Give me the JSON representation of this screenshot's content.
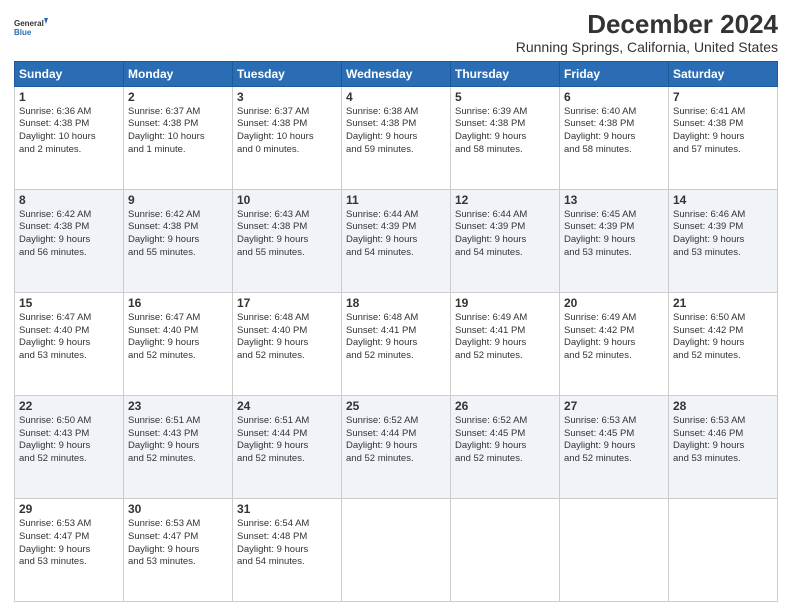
{
  "header": {
    "logo_line1": "General",
    "logo_line2": "Blue",
    "title": "December 2024",
    "subtitle": "Running Springs, California, United States"
  },
  "calendar": {
    "days_of_week": [
      "Sunday",
      "Monday",
      "Tuesday",
      "Wednesday",
      "Thursday",
      "Friday",
      "Saturday"
    ],
    "weeks": [
      [
        {
          "day": "1",
          "lines": [
            "Sunrise: 6:36 AM",
            "Sunset: 4:38 PM",
            "Daylight: 10 hours",
            "and 2 minutes."
          ]
        },
        {
          "day": "2",
          "lines": [
            "Sunrise: 6:37 AM",
            "Sunset: 4:38 PM",
            "Daylight: 10 hours",
            "and 1 minute."
          ]
        },
        {
          "day": "3",
          "lines": [
            "Sunrise: 6:37 AM",
            "Sunset: 4:38 PM",
            "Daylight: 10 hours",
            "and 0 minutes."
          ]
        },
        {
          "day": "4",
          "lines": [
            "Sunrise: 6:38 AM",
            "Sunset: 4:38 PM",
            "Daylight: 9 hours",
            "and 59 minutes."
          ]
        },
        {
          "day": "5",
          "lines": [
            "Sunrise: 6:39 AM",
            "Sunset: 4:38 PM",
            "Daylight: 9 hours",
            "and 58 minutes."
          ]
        },
        {
          "day": "6",
          "lines": [
            "Sunrise: 6:40 AM",
            "Sunset: 4:38 PM",
            "Daylight: 9 hours",
            "and 58 minutes."
          ]
        },
        {
          "day": "7",
          "lines": [
            "Sunrise: 6:41 AM",
            "Sunset: 4:38 PM",
            "Daylight: 9 hours",
            "and 57 minutes."
          ]
        }
      ],
      [
        {
          "day": "8",
          "lines": [
            "Sunrise: 6:42 AM",
            "Sunset: 4:38 PM",
            "Daylight: 9 hours",
            "and 56 minutes."
          ]
        },
        {
          "day": "9",
          "lines": [
            "Sunrise: 6:42 AM",
            "Sunset: 4:38 PM",
            "Daylight: 9 hours",
            "and 55 minutes."
          ]
        },
        {
          "day": "10",
          "lines": [
            "Sunrise: 6:43 AM",
            "Sunset: 4:38 PM",
            "Daylight: 9 hours",
            "and 55 minutes."
          ]
        },
        {
          "day": "11",
          "lines": [
            "Sunrise: 6:44 AM",
            "Sunset: 4:39 PM",
            "Daylight: 9 hours",
            "and 54 minutes."
          ]
        },
        {
          "day": "12",
          "lines": [
            "Sunrise: 6:44 AM",
            "Sunset: 4:39 PM",
            "Daylight: 9 hours",
            "and 54 minutes."
          ]
        },
        {
          "day": "13",
          "lines": [
            "Sunrise: 6:45 AM",
            "Sunset: 4:39 PM",
            "Daylight: 9 hours",
            "and 53 minutes."
          ]
        },
        {
          "day": "14",
          "lines": [
            "Sunrise: 6:46 AM",
            "Sunset: 4:39 PM",
            "Daylight: 9 hours",
            "and 53 minutes."
          ]
        }
      ],
      [
        {
          "day": "15",
          "lines": [
            "Sunrise: 6:47 AM",
            "Sunset: 4:40 PM",
            "Daylight: 9 hours",
            "and 53 minutes."
          ]
        },
        {
          "day": "16",
          "lines": [
            "Sunrise: 6:47 AM",
            "Sunset: 4:40 PM",
            "Daylight: 9 hours",
            "and 52 minutes."
          ]
        },
        {
          "day": "17",
          "lines": [
            "Sunrise: 6:48 AM",
            "Sunset: 4:40 PM",
            "Daylight: 9 hours",
            "and 52 minutes."
          ]
        },
        {
          "day": "18",
          "lines": [
            "Sunrise: 6:48 AM",
            "Sunset: 4:41 PM",
            "Daylight: 9 hours",
            "and 52 minutes."
          ]
        },
        {
          "day": "19",
          "lines": [
            "Sunrise: 6:49 AM",
            "Sunset: 4:41 PM",
            "Daylight: 9 hours",
            "and 52 minutes."
          ]
        },
        {
          "day": "20",
          "lines": [
            "Sunrise: 6:49 AM",
            "Sunset: 4:42 PM",
            "Daylight: 9 hours",
            "and 52 minutes."
          ]
        },
        {
          "day": "21",
          "lines": [
            "Sunrise: 6:50 AM",
            "Sunset: 4:42 PM",
            "Daylight: 9 hours",
            "and 52 minutes."
          ]
        }
      ],
      [
        {
          "day": "22",
          "lines": [
            "Sunrise: 6:50 AM",
            "Sunset: 4:43 PM",
            "Daylight: 9 hours",
            "and 52 minutes."
          ]
        },
        {
          "day": "23",
          "lines": [
            "Sunrise: 6:51 AM",
            "Sunset: 4:43 PM",
            "Daylight: 9 hours",
            "and 52 minutes."
          ]
        },
        {
          "day": "24",
          "lines": [
            "Sunrise: 6:51 AM",
            "Sunset: 4:44 PM",
            "Daylight: 9 hours",
            "and 52 minutes."
          ]
        },
        {
          "day": "25",
          "lines": [
            "Sunrise: 6:52 AM",
            "Sunset: 4:44 PM",
            "Daylight: 9 hours",
            "and 52 minutes."
          ]
        },
        {
          "day": "26",
          "lines": [
            "Sunrise: 6:52 AM",
            "Sunset: 4:45 PM",
            "Daylight: 9 hours",
            "and 52 minutes."
          ]
        },
        {
          "day": "27",
          "lines": [
            "Sunrise: 6:53 AM",
            "Sunset: 4:45 PM",
            "Daylight: 9 hours",
            "and 52 minutes."
          ]
        },
        {
          "day": "28",
          "lines": [
            "Sunrise: 6:53 AM",
            "Sunset: 4:46 PM",
            "Daylight: 9 hours",
            "and 53 minutes."
          ]
        }
      ],
      [
        {
          "day": "29",
          "lines": [
            "Sunrise: 6:53 AM",
            "Sunset: 4:47 PM",
            "Daylight: 9 hours",
            "and 53 minutes."
          ]
        },
        {
          "day": "30",
          "lines": [
            "Sunrise: 6:53 AM",
            "Sunset: 4:47 PM",
            "Daylight: 9 hours",
            "and 53 minutes."
          ]
        },
        {
          "day": "31",
          "lines": [
            "Sunrise: 6:54 AM",
            "Sunset: 4:48 PM",
            "Daylight: 9 hours",
            "and 54 minutes."
          ]
        },
        null,
        null,
        null,
        null
      ]
    ]
  }
}
